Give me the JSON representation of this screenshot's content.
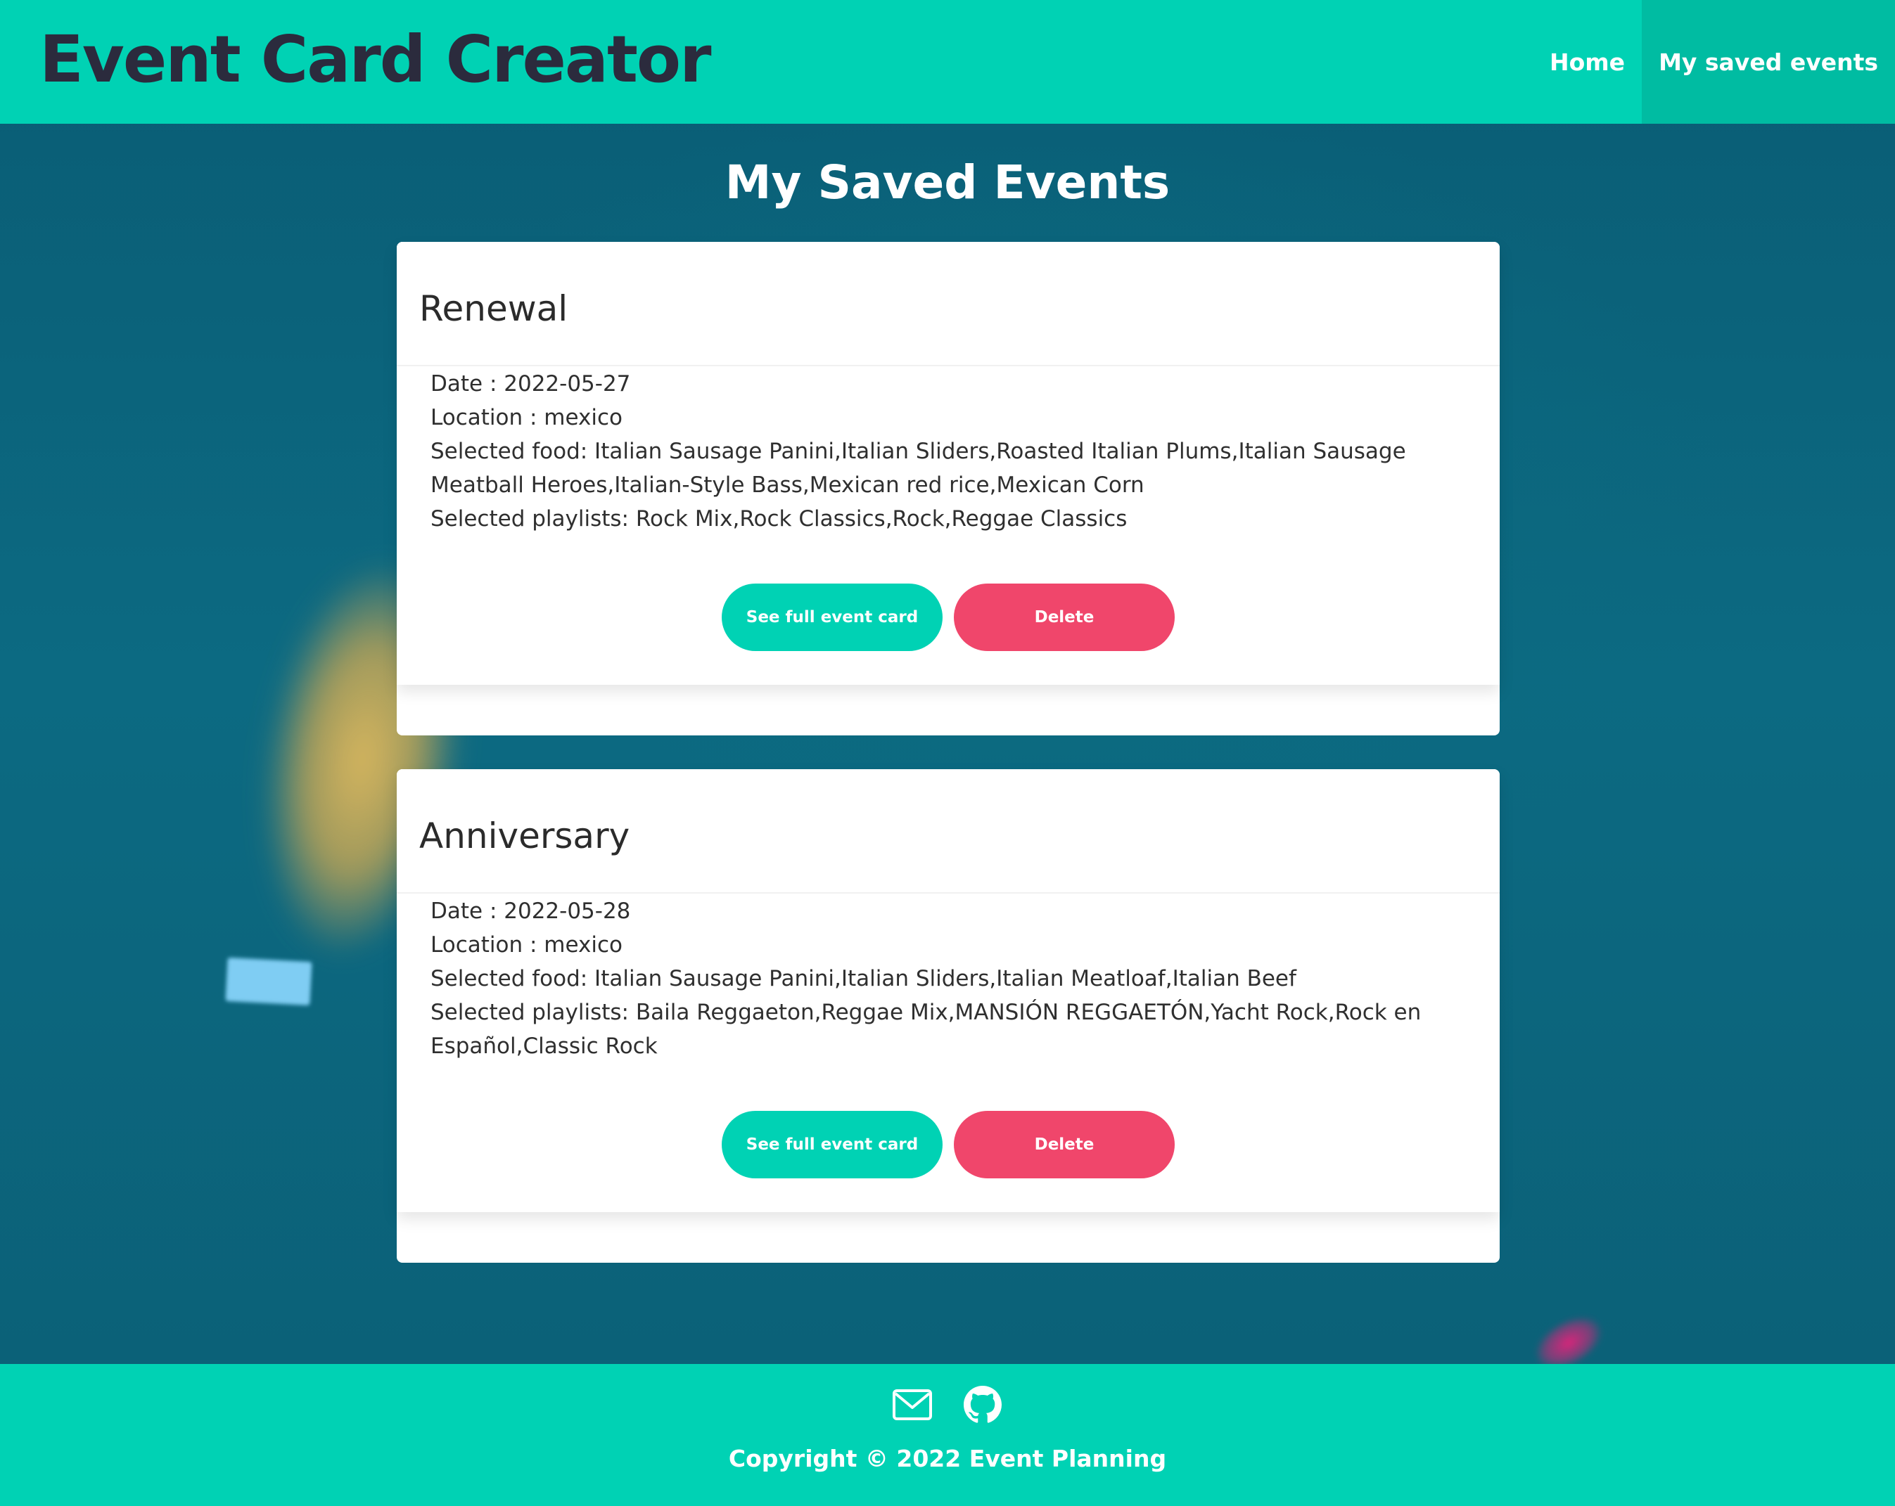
{
  "header": {
    "brand": "Event Card Creator",
    "nav": [
      {
        "label": "Home",
        "active": false
      },
      {
        "label": "My saved events",
        "active": true
      }
    ]
  },
  "main": {
    "title": "My Saved Events",
    "events": [
      {
        "name": "Renewal",
        "date_line": "Date : 2022-05-27",
        "location_line": "Location : mexico",
        "food_line": "Selected food: Italian Sausage Panini,Italian Sliders,Roasted Italian Plums,Italian Sausage Meatball Heroes,Italian-Style Bass,Mexican red rice,Mexican Corn",
        "playlists_line": "Selected playlists: Rock Mix,Rock Classics,Rock,Reggae Classics",
        "see_button": "See full event card",
        "delete_button": "Delete"
      },
      {
        "name": "Anniversary",
        "date_line": "Date : 2022-05-28",
        "location_line": "Location : mexico",
        "food_line": "Selected food: Italian Sausage Panini,Italian Sliders,Italian Meatloaf,Italian Beef",
        "playlists_line": "Selected playlists: Baila Reggaeton,Reggae Mix,MANSIÓN REGGAETÓN,Yacht Rock,Rock en Español,Classic Rock",
        "see_button": "See full event card",
        "delete_button": "Delete"
      }
    ]
  },
  "footer": {
    "icons": [
      "mail-icon",
      "github-icon"
    ],
    "copyright": "Copyright © 2022 Event Planning"
  },
  "colors": {
    "accent": "#00d2b4",
    "nav_active": "#00bca2",
    "danger": "#f0466b",
    "brand_text": "#2b2b3d",
    "background": "#0c6178"
  }
}
